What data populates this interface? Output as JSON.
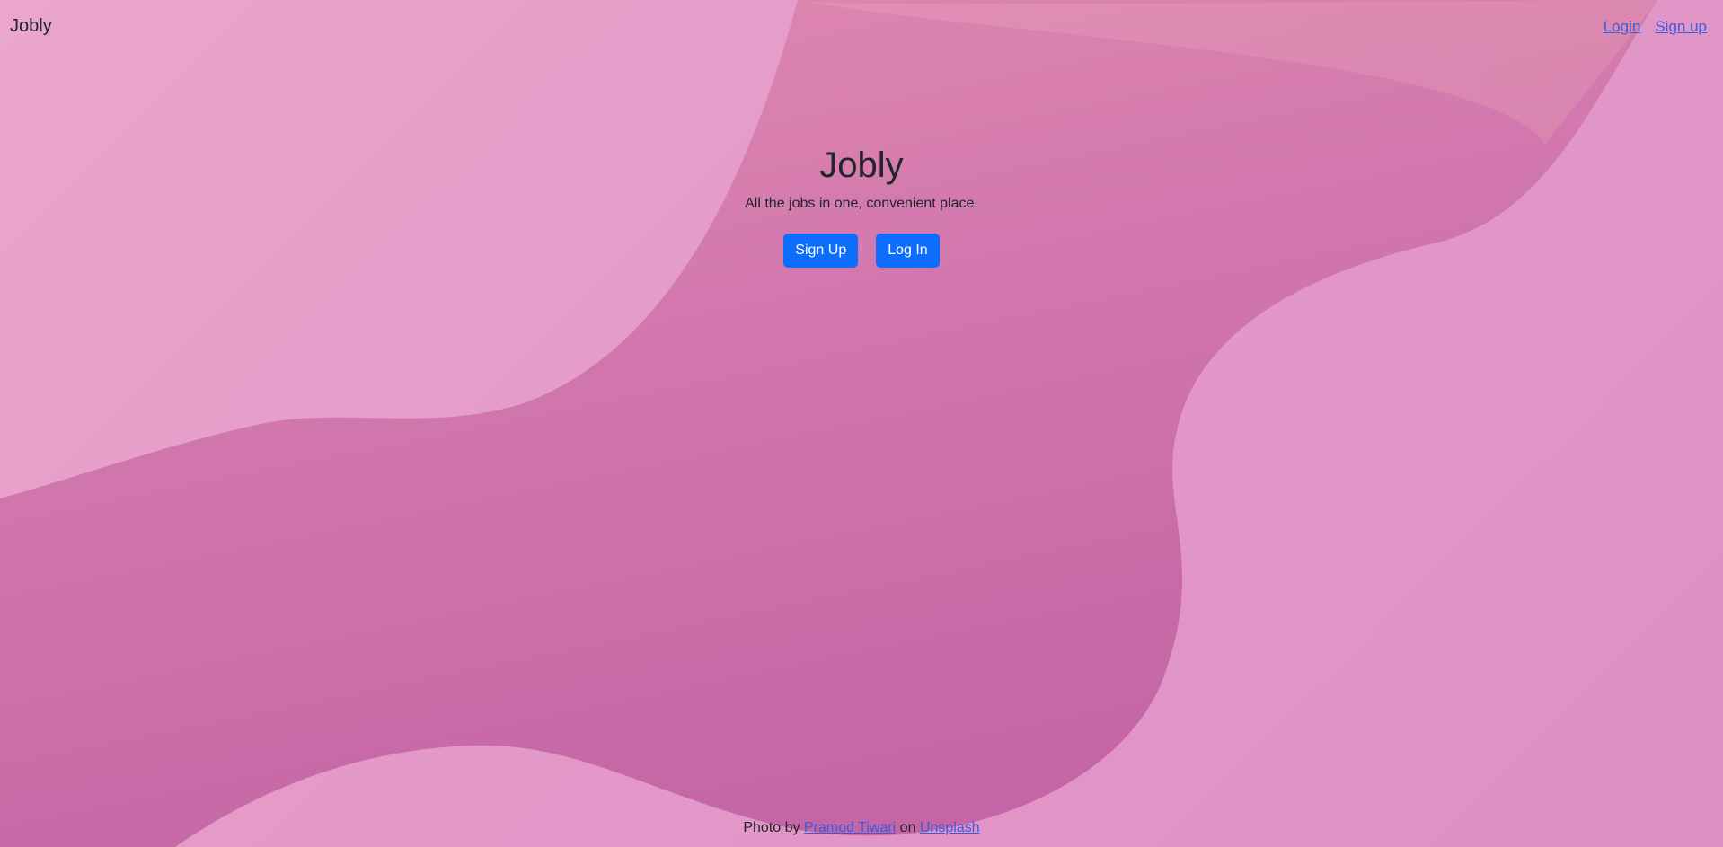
{
  "navbar": {
    "brand": "Jobly",
    "links": [
      {
        "label": "Login"
      },
      {
        "label": "Sign up"
      }
    ]
  },
  "hero": {
    "title": "Jobly",
    "tagline": "All the jobs in one, convenient place.",
    "signup_button": "Sign Up",
    "login_button": "Log In"
  },
  "credit": {
    "prefix": "Photo by",
    "author": "Pramod Tiwari",
    "middle": "on",
    "site": "Unsplash"
  },
  "colors": {
    "accent": "#0d6efd",
    "link": "#3b5bd9",
    "background_light": "#e8a0ca",
    "background_dark": "#c767a6"
  }
}
